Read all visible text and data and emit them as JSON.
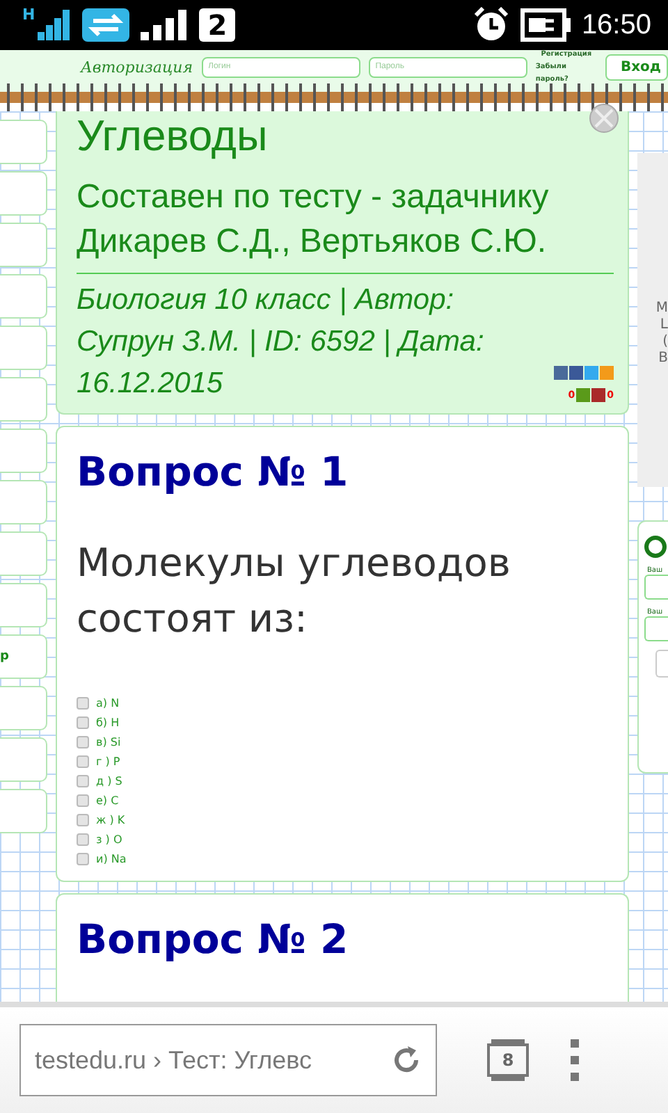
{
  "status_bar": {
    "network": "H",
    "sim": "2",
    "time": "16:50"
  },
  "header": {
    "auth_title": "Авторизация",
    "login_placeholder": "Логин",
    "password_placeholder": "Пароль",
    "register_link": "Регистрация",
    "forgot_link": "Забыли пароль?",
    "login_button": "Вход"
  },
  "sidebar": {
    "fragment": "р"
  },
  "test": {
    "title": "Углеводы",
    "subtitle": "Составен по тесту - задачнику Дикарев С.Д., Вертьяков С.Ю.",
    "meta": "Биология 10 класс | Автор: Супрун З.М. | ID: 6592 | Дата: 16.12.2015",
    "likes": "0",
    "dislikes": "0"
  },
  "questions": [
    {
      "heading": "Вопрос № 1",
      "text": "Молекулы углеводов состоят из:",
      "options": [
        {
          "label": "а) N",
          "checked": false
        },
        {
          "label": "б) H",
          "checked": false
        },
        {
          "label": "в) Si",
          "checked": false
        },
        {
          "label": "г ) P",
          "checked": false
        },
        {
          "label": "д ) S",
          "checked": false
        },
        {
          "label": "е) C",
          "checked": false
        },
        {
          "label": "ж ) K",
          "checked": false
        },
        {
          "label": "з ) O",
          "checked": false
        },
        {
          "label": "и) Na",
          "checked": false
        }
      ]
    },
    {
      "heading": "Вопрос № 2"
    }
  ],
  "right_panel": {
    "fragments": [
      "М",
      "L",
      "(",
      "В"
    ],
    "field_labels": [
      "Ваш",
      "Ваш"
    ]
  },
  "browser": {
    "url": "testedu.ru › Тест: Углевс",
    "tabs_count": "8"
  }
}
